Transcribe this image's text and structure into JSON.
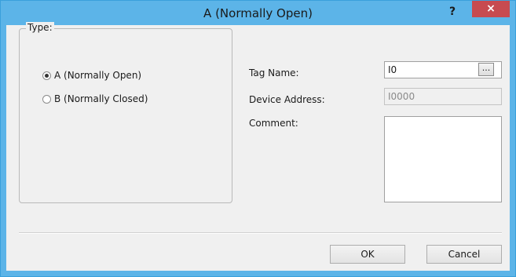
{
  "window": {
    "title": "A (Normally Open)",
    "help_label": "?",
    "close_label": "×"
  },
  "type_group": {
    "legend": "Type:",
    "options": [
      {
        "label": "A (Normally Open)",
        "checked": true
      },
      {
        "label": "B (Normally Closed)",
        "checked": false
      }
    ]
  },
  "fields": {
    "tag_name_label": "Tag Name:",
    "tag_name_value": "I0",
    "browse_label": "...",
    "device_address_label": "Device Address:",
    "device_address_value": "I0000",
    "comment_label": "Comment:",
    "comment_value": ""
  },
  "buttons": {
    "ok": "OK",
    "cancel": "Cancel"
  },
  "colors": {
    "titlebar": "#5cb4e8",
    "close_button": "#c74b50",
    "client_background": "#f0f0f0"
  }
}
